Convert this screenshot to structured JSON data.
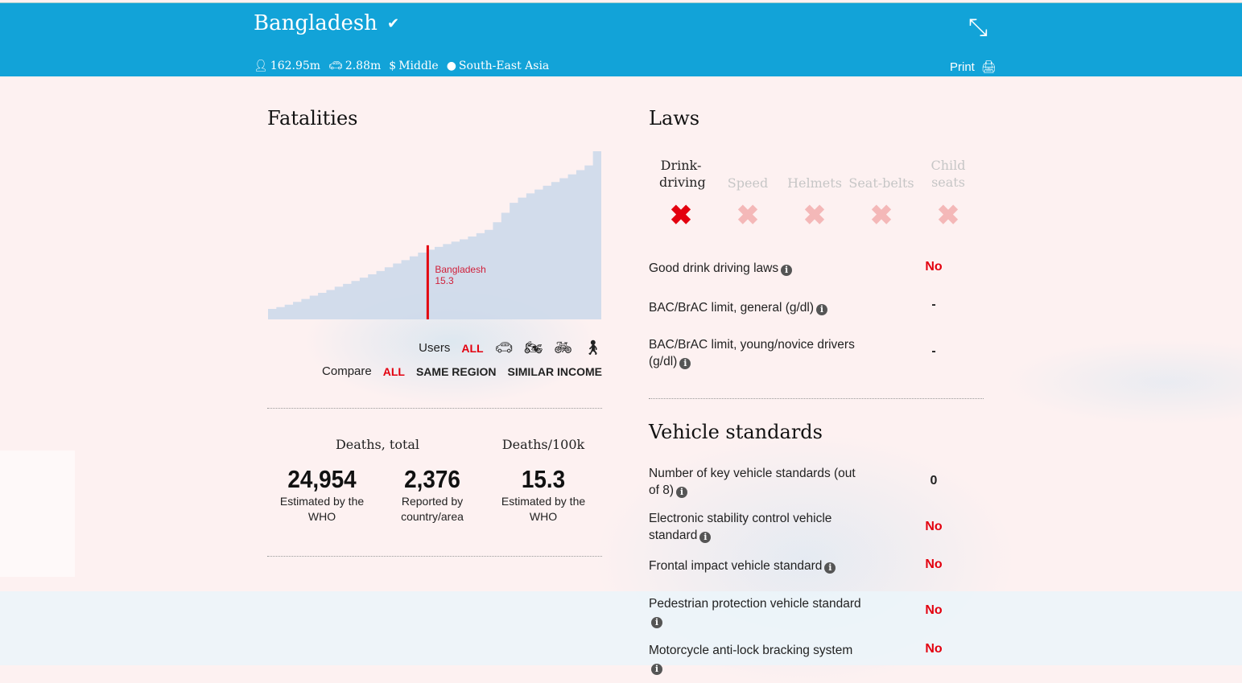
{
  "header": {
    "country": "Bangladesh",
    "population": "162.95m",
    "vehicles": "2.88m",
    "income": "Middle",
    "region": "South-East Asia",
    "print_label": "Print",
    "color": "#12a3d8"
  },
  "fatalities": {
    "title": "Fatalities",
    "users_label": "Users",
    "users_all": "ALL",
    "user_icons": [
      "car-icon",
      "motorcycle-icon",
      "bicycle-icon",
      "pedestrian-icon"
    ],
    "compare_label": "Compare",
    "compare_options": [
      "ALL",
      "SAME REGION",
      "SIMILAR INCOME"
    ],
    "deaths_total_label": "Deaths, total",
    "deaths_100k_label": "Deaths/100k",
    "stats": [
      {
        "value": "24,954",
        "sub": "Estimated by the WHO"
      },
      {
        "value": "2,376",
        "sub": "Reported by country/area"
      },
      {
        "value": "15.3",
        "sub": "Estimated by the WHO"
      }
    ]
  },
  "chart_data": {
    "type": "area",
    "values": [
      2.2,
      2.6,
      3.1,
      3.7,
      4.3,
      5.0,
      5.6,
      6.2,
      6.9,
      7.5,
      8.1,
      8.8,
      9.5,
      10.2,
      11.0,
      11.8,
      12.5,
      13.3,
      14.1,
      14.7,
      15.3,
      15.9,
      16.4,
      16.9,
      17.5,
      18.2,
      18.9,
      20.5,
      22.5,
      24.6,
      25.7,
      26.6,
      27.4,
      28.2,
      29.0,
      29.8,
      30.6,
      31.5,
      32.5,
      35.5
    ],
    "highlight": {
      "label": "Bangladesh",
      "value": "15.3",
      "index": 20
    },
    "ylim": [
      0,
      36
    ],
    "fill": "#cdd9ea",
    "highlight_color": "#e3000f"
  },
  "laws": {
    "title": "Laws",
    "categories": [
      {
        "label": "Drink-driving",
        "active": true
      },
      {
        "label": "Speed",
        "active": false
      },
      {
        "label": "Helmets",
        "active": false
      },
      {
        "label": "Seat-belts",
        "active": false
      },
      {
        "label": "Child seats",
        "active": false
      }
    ],
    "rows": [
      {
        "label": "Good drink driving laws",
        "value": "No"
      },
      {
        "label": "BAC/BrAC limit, general (g/dl)",
        "value": "-"
      },
      {
        "label": "BAC/BrAC limit, young/novice drivers (g/dl)",
        "value": "-"
      }
    ]
  },
  "vehicle": {
    "title": "Vehicle standards",
    "rows": [
      {
        "label": "Number of key vehicle standards (out of 8)",
        "value": "0"
      },
      {
        "label": "Electronic stability control vehicle standard",
        "value": "No"
      },
      {
        "label": "Frontal impact vehicle standard",
        "value": "No"
      },
      {
        "label": "Pedestrian protection vehicle standard",
        "value": "No"
      },
      {
        "label": "Motorcycle anti-lock bracking system",
        "value": "No"
      }
    ]
  }
}
